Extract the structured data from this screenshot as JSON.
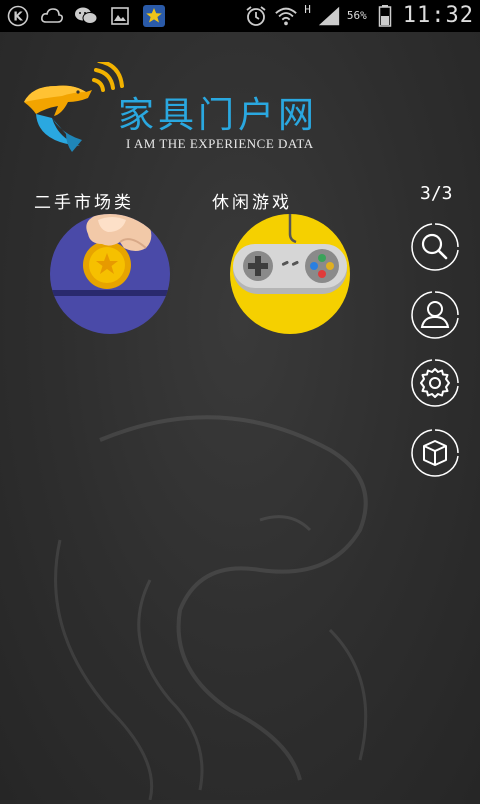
{
  "status_bar": {
    "time": "11:32",
    "battery_percent": "56%",
    "network_type": "H",
    "icons": [
      "k-app-icon",
      "cloud-icon",
      "wechat-icon",
      "gallery-icon",
      "star-app-icon",
      "alarm-icon",
      "wifi-icon",
      "signal-icon",
      "battery-icon"
    ]
  },
  "header": {
    "title": "家具门户网",
    "subtitle": "I AM THE EXPERIENCE DATA"
  },
  "page_indicator": "3/3",
  "apps": [
    {
      "label": "二手市场类",
      "icon": "coin-hand-icon",
      "bg": "#4a4aa8"
    },
    {
      "label": "休闲游戏",
      "icon": "gamepad-icon",
      "bg": "#f5d000"
    }
  ],
  "side_actions": [
    {
      "icon": "search-icon"
    },
    {
      "icon": "user-icon"
    },
    {
      "icon": "settings-icon"
    },
    {
      "icon": "box-icon"
    }
  ],
  "colors": {
    "accent": "#2aa8e0",
    "background": "#2e2e2e"
  }
}
